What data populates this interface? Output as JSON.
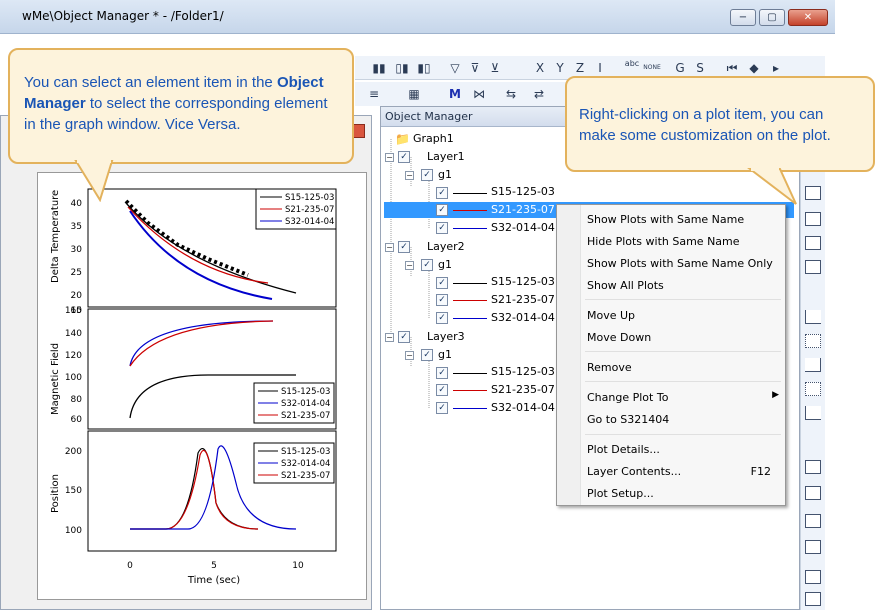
{
  "window": {
    "title": "wMe\\Object Manager * - /Folder1/",
    "min": "−",
    "max": "▢",
    "close": "✕"
  },
  "toolbar": {
    "x": "X",
    "y": "Y",
    "z": "Z",
    "i": "I",
    "abc": "abc",
    "none": "NONE",
    "g": "G",
    "s": "S"
  },
  "callout_left": {
    "text1": "You can select an element item in the ",
    "bold1": "Object Manager",
    "text2": " to select the corresponding element in the graph window. Vice Versa."
  },
  "callout_right": {
    "text": "Right-clicking on a plot item,  you can make some customization on the plot."
  },
  "object_manager": {
    "header": "Object Manager",
    "graph": "Graph1",
    "layers": [
      {
        "name": "Layer1",
        "group": "g1",
        "plots": [
          {
            "name": "S15-125-03",
            "color": "#000000"
          },
          {
            "name": "S21-235-07",
            "color": "#cc0000"
          },
          {
            "name": "S32-014-04",
            "color": "#0000cc"
          }
        ]
      },
      {
        "name": "Layer2",
        "group": "g1",
        "plots": [
          {
            "name": "S15-125-03",
            "color": "#000000"
          },
          {
            "name": "S21-235-07",
            "color": "#cc0000"
          },
          {
            "name": "S32-014-04",
            "color": "#0000cc"
          }
        ]
      },
      {
        "name": "Layer3",
        "group": "g1",
        "plots": [
          {
            "name": "S15-125-03",
            "color": "#000000"
          },
          {
            "name": "S21-235-07",
            "color": "#cc0000"
          },
          {
            "name": "S32-014-04",
            "color": "#0000cc"
          }
        ]
      }
    ]
  },
  "context_menu": {
    "show_same_name": "Show Plots with Same Name",
    "hide_same_name": "Hide Plots with Same Name",
    "show_same_name_only": "Show Plots with Same Name Only",
    "show_all": "Show All Plots",
    "move_up": "Move Up",
    "move_down": "Move Down",
    "remove": "Remove",
    "change_plot_to": "Change Plot To",
    "go_to": "Go to S321404",
    "plot_details": "Plot Details...",
    "layer_contents": "Layer Contents...",
    "layer_contents_shortcut": "F12",
    "plot_setup": "Plot Setup..."
  },
  "graph": {
    "layer1": {
      "ylabel": "Delta Temperature",
      "yticks": [
        "40",
        "35",
        "30",
        "25",
        "20",
        "15"
      ],
      "legend": [
        "S15-125-03",
        "S21-235-07",
        "S32-014-04"
      ],
      "legend_colors": [
        "#000000",
        "#cc0000",
        "#0000cc"
      ]
    },
    "layer2": {
      "ylabel": "Magnetic Field",
      "yticks": [
        "160",
        "140",
        "120",
        "100",
        "80",
        "60"
      ],
      "legend": [
        "S15-125-03",
        "S32-014-04",
        "S21-235-07"
      ],
      "legend_colors": [
        "#000000",
        "#0000cc",
        "#cc0000"
      ]
    },
    "layer3": {
      "ylabel": "Position",
      "yticks": [
        "200",
        "150",
        "100"
      ],
      "legend": [
        "S15-125-03",
        "S32-014-04",
        "S21-235-07"
      ],
      "legend_colors": [
        "#000000",
        "#0000cc",
        "#cc0000"
      ]
    },
    "xticks": [
      "0",
      "5",
      "10"
    ],
    "xlabel": "Time (sec)"
  }
}
